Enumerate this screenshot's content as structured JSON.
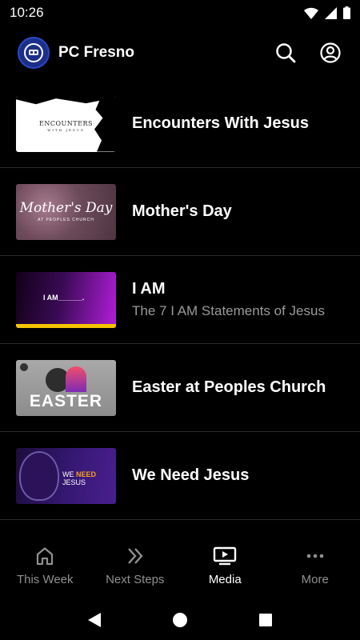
{
  "status_bar": {
    "time": "10:26"
  },
  "header": {
    "app_title": "PC Fresno",
    "search_icon": "search-icon",
    "account_icon": "account-circle-icon"
  },
  "media_items": [
    {
      "title": "Encounters With Jesus",
      "subtitle": "",
      "thumb_text": "ENCOUNTERS",
      "thumb_sub": "WITH JESUS"
    },
    {
      "title": "Mother's Day",
      "subtitle": "",
      "thumb_text": "Mother's Day",
      "thumb_sub": "AT PEOPLES CHURCH"
    },
    {
      "title": "I AM",
      "subtitle": "The 7 I AM Statements of Jesus",
      "thumb_text": "I AM______."
    },
    {
      "title": "Easter at Peoples Church",
      "subtitle": "",
      "thumb_text": "EASTER"
    },
    {
      "title": "We Need Jesus",
      "subtitle": "",
      "thumb_text_a": "WE ",
      "thumb_text_b": "NEED",
      "thumb_text_c": " JESUS"
    }
  ],
  "bottom_nav": {
    "items": [
      {
        "label": "This Week",
        "icon": "home-icon"
      },
      {
        "label": "Next Steps",
        "icon": "double-chevron-right-icon"
      },
      {
        "label": "Media",
        "icon": "tv-play-icon",
        "active": true
      },
      {
        "label": "More",
        "icon": "more-horizontal-icon"
      }
    ]
  },
  "colors": {
    "background": "#000000",
    "inactive": "#8f8f8f",
    "active": "#ffffff",
    "brand": "#1b2f8a"
  }
}
